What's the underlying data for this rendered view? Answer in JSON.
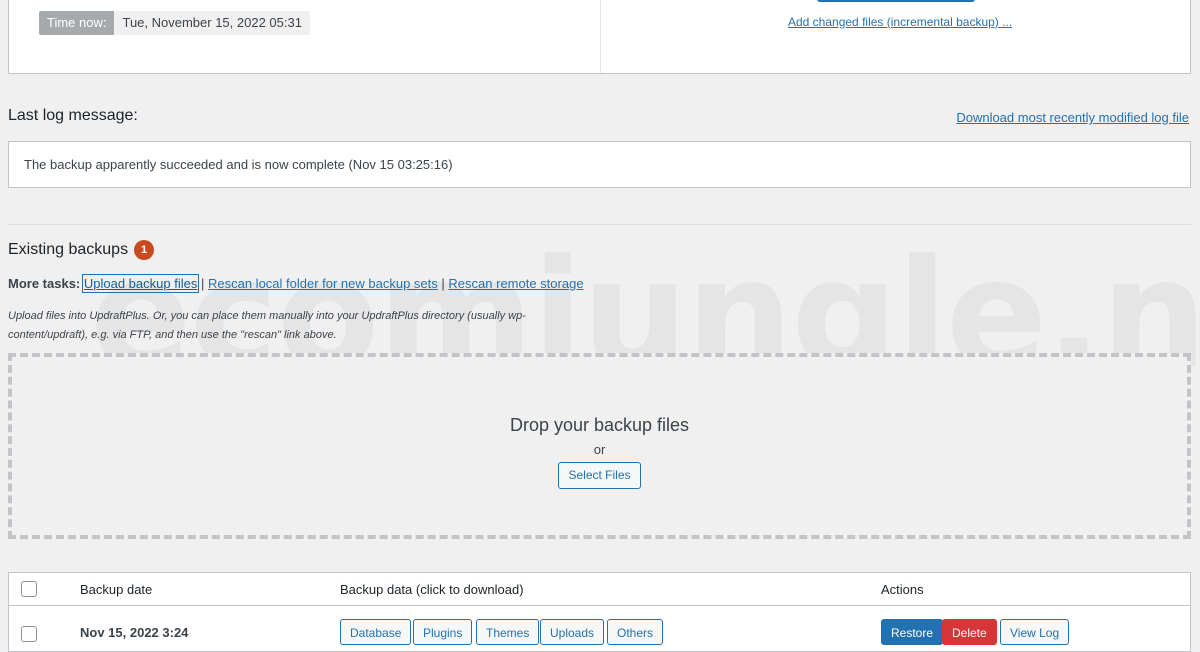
{
  "status": {
    "time_label": "Time now:",
    "time_value": "Tue, November 15, 2022 05:31",
    "incremental_link": "Add changed files (incremental backup) ..."
  },
  "last_log": {
    "heading": "Last log message:",
    "download_link": "Download most recently modified log file",
    "message": "The backup apparently succeeded and is now complete (Nov 15 03:25:16)"
  },
  "existing_backups": {
    "heading": "Existing backups",
    "count": "1",
    "more_tasks_label": "More tasks:",
    "tasks": [
      "Upload backup files",
      "Rescan local folder for new backup sets",
      "Rescan remote storage"
    ],
    "separator": "|",
    "upload_help": "Upload files into UpdraftPlus. Or, you can place them manually into your UpdraftPlus directory (usually wp-content/updraft), e.g. via FTP, and then use the \"rescan\" link above.",
    "dropzone_title": "Drop your backup files",
    "dropzone_or": "or",
    "select_files": "Select Files"
  },
  "table": {
    "columns": [
      "Backup date",
      "Backup data (click to download)",
      "Actions"
    ],
    "rows": [
      {
        "date": "Nov 15, 2022 3:24",
        "data_buttons": [
          "Database",
          "Plugins",
          "Themes",
          "Uploads",
          "Others"
        ],
        "actions": [
          "Restore",
          "Delete",
          "View Log"
        ]
      }
    ]
  },
  "watermark": "ecomjungle.net",
  "colors": {
    "primary": "#2271b1",
    "danger": "#d63638",
    "badge": "#ca4a1f",
    "background": "#f0f0f1"
  }
}
